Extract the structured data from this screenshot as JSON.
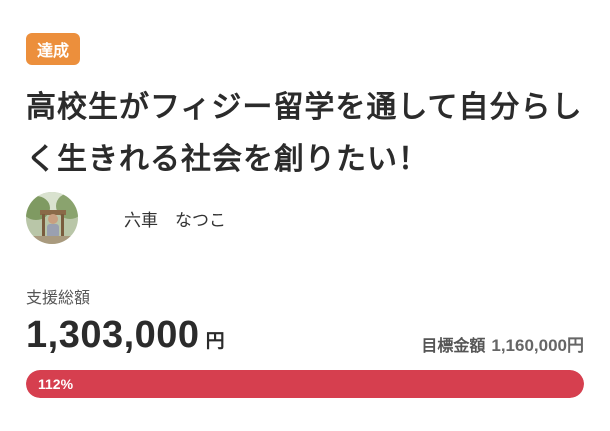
{
  "project": {
    "status_badge": "達成",
    "title": "高校生がフィジー留学を通して自分らしく生きれる社会を創りたい！",
    "owner_name": "六車　なつこ"
  },
  "funding": {
    "support_label": "支援総額",
    "amount": "1,303,000",
    "amount_unit": "円",
    "goal_label": "目標金額",
    "goal_amount": "1,160,000円",
    "progress_text": "112%",
    "progress_percent": 112
  },
  "colors": {
    "badge": "#ec8f3c",
    "progress": "#d63f4f",
    "text": "#2b2b2b"
  },
  "icons": {
    "avatar": "owner-avatar-photo"
  }
}
